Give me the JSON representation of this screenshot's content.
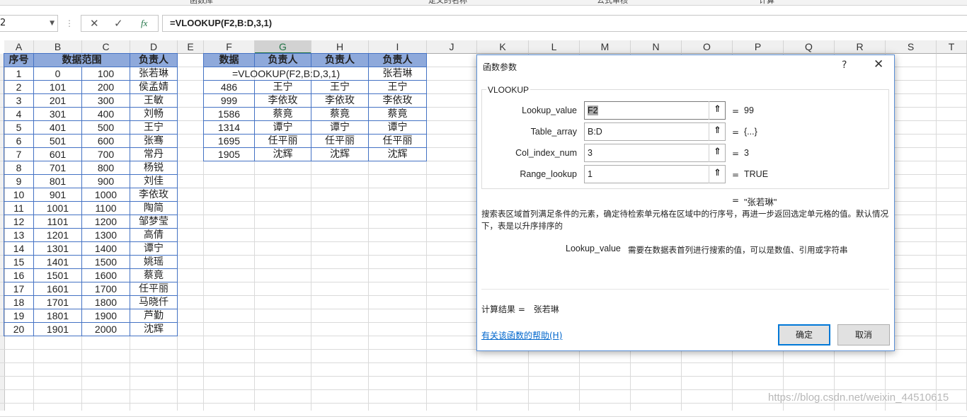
{
  "ribbon": {
    "groups": [
      "函数库",
      "定义的名称",
      "公式审核",
      "计算"
    ]
  },
  "formula_bar": {
    "name_box": "2",
    "cancel_icon": "✕",
    "enter_icon": "✓",
    "fx_icon": "fx",
    "formula": "=VLOOKUP(F2,B:D,3,1)"
  },
  "columns": [
    "A",
    "B",
    "C",
    "D",
    "E",
    "F",
    "G",
    "H",
    "I",
    "J",
    "K",
    "L",
    "M",
    "N",
    "O",
    "P",
    "Q",
    "R",
    "S",
    "T"
  ],
  "selected_column": "G",
  "left_table": {
    "headers": [
      "序号",
      "数据范围",
      "负责人"
    ],
    "rows": [
      [
        "1",
        "0",
        "100",
        "张若琳"
      ],
      [
        "2",
        "101",
        "200",
        "侯孟婧"
      ],
      [
        "3",
        "201",
        "300",
        "王敏"
      ],
      [
        "4",
        "301",
        "400",
        "刘畅"
      ],
      [
        "5",
        "401",
        "500",
        "王宁"
      ],
      [
        "6",
        "501",
        "600",
        "张骞"
      ],
      [
        "7",
        "601",
        "700",
        "常丹"
      ],
      [
        "8",
        "701",
        "800",
        "杨锐"
      ],
      [
        "9",
        "801",
        "900",
        "刘佳"
      ],
      [
        "10",
        "901",
        "1000",
        "李依玫"
      ],
      [
        "11",
        "1001",
        "1100",
        "陶简"
      ],
      [
        "12",
        "1101",
        "1200",
        "邹梦莹"
      ],
      [
        "13",
        "1201",
        "1300",
        "高倩"
      ],
      [
        "14",
        "1301",
        "1400",
        "谭宁"
      ],
      [
        "15",
        "1401",
        "1500",
        "姚瑶"
      ],
      [
        "16",
        "1501",
        "1600",
        "蔡竟"
      ],
      [
        "17",
        "1601",
        "1700",
        "任平丽"
      ],
      [
        "18",
        "1701",
        "1800",
        "马晓仟"
      ],
      [
        "19",
        "1801",
        "1900",
        "芦勤"
      ],
      [
        "20",
        "1901",
        "2000",
        "沈辉"
      ]
    ]
  },
  "right_table": {
    "headers": [
      "数据",
      "负责人",
      "负责人",
      "负责人"
    ],
    "first_row": {
      "formula": "=VLOOKUP(F2,B:D,3,1)",
      "i_value": "张若琳"
    },
    "rows": [
      [
        "486",
        "王宁",
        "王宁",
        "王宁"
      ],
      [
        "999",
        "李依玫",
        "李依玫",
        "李依玫"
      ],
      [
        "1586",
        "蔡竟",
        "蔡竟",
        "蔡竟"
      ],
      [
        "1314",
        "谭宁",
        "谭宁",
        "谭宁"
      ],
      [
        "1695",
        "任平丽",
        "任平丽",
        "任平丽"
      ],
      [
        "1905",
        "沈辉",
        "沈辉",
        "沈辉"
      ]
    ]
  },
  "dialog": {
    "title": "函数参数",
    "help_icon": "?",
    "close_icon": "✕",
    "function_name": "VLOOKUP",
    "args": [
      {
        "label": "Lookup_value",
        "value": "F2",
        "result": "99"
      },
      {
        "label": "Table_array",
        "value": "B:D",
        "result": "{...}"
      },
      {
        "label": "Col_index_num",
        "value": "3",
        "result": "3"
      },
      {
        "label": "Range_lookup",
        "value": "1",
        "result": "TRUE"
      }
    ],
    "ref_icon": "⇑",
    "eq": "=",
    "formula_result": "\"张若琳\"",
    "description": "搜索表区域首列满足条件的元素，确定待检索单元格在区域中的行序号，再进一步返回选定单元格的值。默认情况下，表是以升序排序的",
    "arg_desc_name": "Lookup_value",
    "arg_desc_text": "需要在数据表首列进行搜索的值，可以是数值、引用或字符串",
    "calc_label": "计算结果 =",
    "calc_value": "张若琳",
    "help_link": "有关该函数的帮助(H)",
    "ok": "确定",
    "cancel": "取消"
  },
  "watermark": "https://blog.csdn.net/weixin_44510615"
}
